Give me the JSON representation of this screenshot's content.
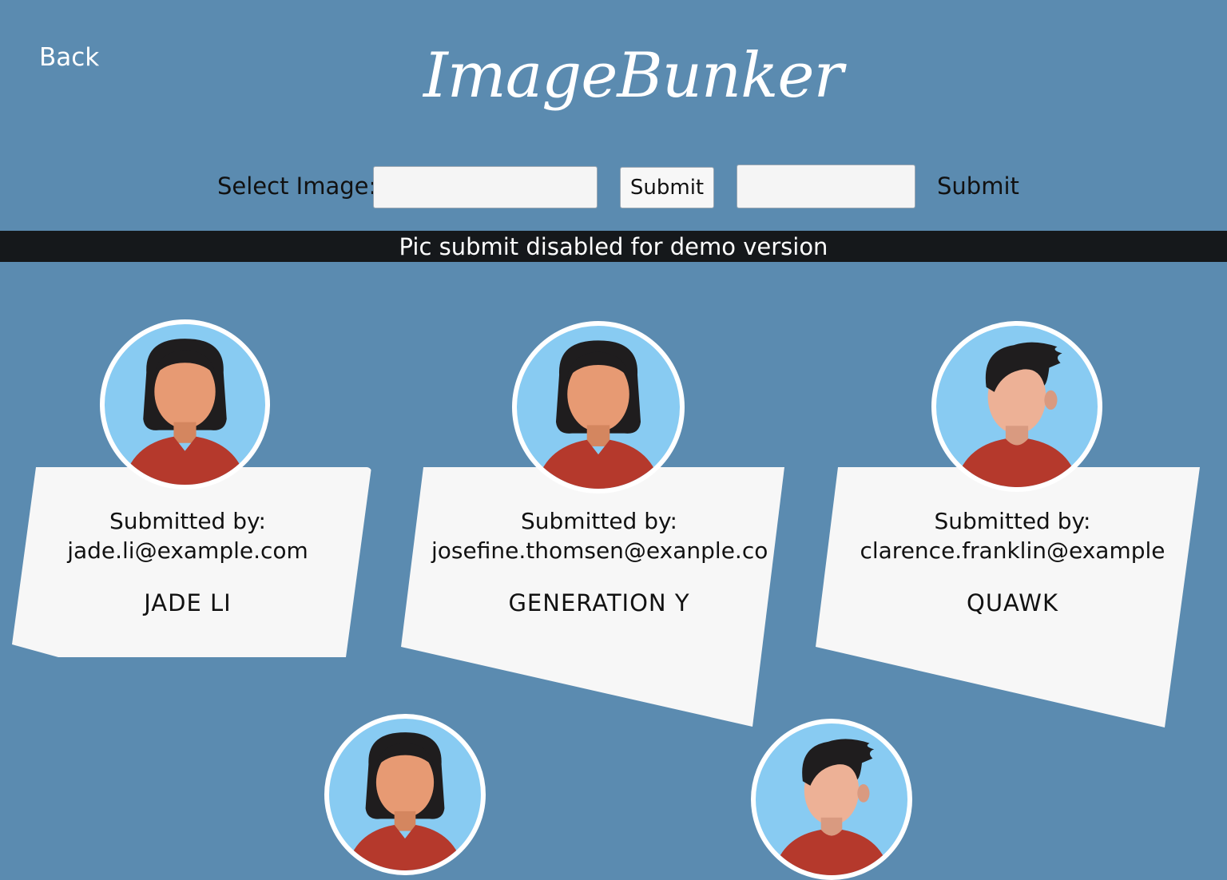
{
  "nav": {
    "back_label": "Back"
  },
  "header": {
    "brand": "ImageBunker"
  },
  "upload": {
    "select_label": "Select Image:",
    "image_input_value": "",
    "submit_button_label": "Submit",
    "second_input_value": "",
    "submit_text_label": "Submit"
  },
  "notice": {
    "text": "Pic submit disabled for demo version"
  },
  "cards": [
    {
      "submitted_by_label": "Submitted by:",
      "email": "jade.li@example.com",
      "title": "JADE LI",
      "avatar_icon": "female-avatar-icon"
    },
    {
      "submitted_by_label": "Submitted by:",
      "email": "josefine.thomsen@exanple.co",
      "title": "GENERATION Y",
      "avatar_icon": "female-avatar-icon"
    },
    {
      "submitted_by_label": "Submitted by:",
      "email": "clarence.franklin@example",
      "title": "QUAWK",
      "avatar_icon": "male-avatar-icon"
    },
    {
      "avatar_icon": "female-avatar-icon"
    },
    {
      "avatar_icon": "male-avatar-icon"
    }
  ],
  "colors": {
    "background": "#5b8bb0",
    "notice_bar": "#15181b",
    "card": "#f7f7f7",
    "avatar_background": "#88cbf2",
    "shirt": "#b5392c",
    "skin": "#e79a73",
    "hair": "#1f1d1e"
  }
}
